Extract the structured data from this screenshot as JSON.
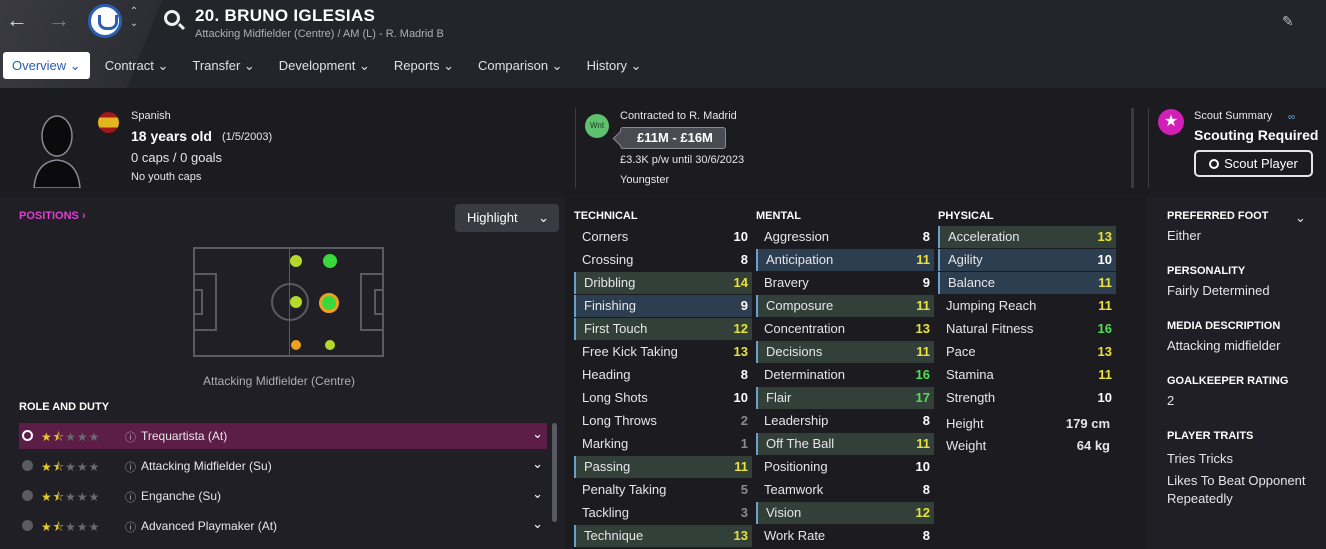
{
  "header": {
    "name": "20. BRUNO IGLESIAS",
    "subtitle": "Attacking Midfielder (Centre) / AM (L) - R. Madrid B"
  },
  "menu": [
    "Overview",
    "Contract",
    "Transfer",
    "Development",
    "Reports",
    "Comparison",
    "History"
  ],
  "bio": {
    "nationality": "Spanish",
    "age": "18 years old",
    "dob": "(1/5/2003)",
    "caps": "0 caps / 0 goals",
    "youth": "No youth caps"
  },
  "contract": {
    "badge": "Wnt",
    "label": "Contracted to R. Madrid",
    "value": "£11M - £16M",
    "wage": "£3.3K p/w until 30/6/2023",
    "status": "Youngster"
  },
  "scout": {
    "label": "Scout Summary",
    "status": "Scouting Required",
    "button": "Scout Player"
  },
  "positions": {
    "label": "POSITIONS",
    "highlight": "Highlight",
    "position_name": "Attacking Midfielder (Centre)"
  },
  "roles": {
    "title": "ROLE AND DUTY",
    "items": [
      "Trequartista (At)",
      "Attacking Midfielder (Su)",
      "Enganche (Su)",
      "Advanced Playmaker (At)"
    ],
    "stars_filled": 1.5,
    "stars_total": 5
  },
  "technical": {
    "title": "TECHNICAL",
    "items": [
      [
        "Corners",
        "10"
      ],
      [
        "Crossing",
        "8"
      ],
      [
        "Dribbling",
        "14"
      ],
      [
        "Finishing",
        "9"
      ],
      [
        "First Touch",
        "12"
      ],
      [
        "Free Kick Taking",
        "13"
      ],
      [
        "Heading",
        "8"
      ],
      [
        "Long Shots",
        "10"
      ],
      [
        "Long Throws",
        "2"
      ],
      [
        "Marking",
        "1"
      ],
      [
        "Passing",
        "11"
      ],
      [
        "Penalty Taking",
        "5"
      ],
      [
        "Tackling",
        "3"
      ],
      [
        "Technique",
        "13"
      ]
    ]
  },
  "mental": {
    "title": "MENTAL",
    "items": [
      [
        "Aggression",
        "8"
      ],
      [
        "Anticipation",
        "11"
      ],
      [
        "Bravery",
        "9"
      ],
      [
        "Composure",
        "11"
      ],
      [
        "Concentration",
        "13"
      ],
      [
        "Decisions",
        "11"
      ],
      [
        "Determination",
        "16"
      ],
      [
        "Flair",
        "17"
      ],
      [
        "Leadership",
        "8"
      ],
      [
        "Off The Ball",
        "11"
      ],
      [
        "Positioning",
        "10"
      ],
      [
        "Teamwork",
        "8"
      ],
      [
        "Vision",
        "12"
      ],
      [
        "Work Rate",
        "8"
      ]
    ]
  },
  "physical": {
    "title": "PHYSICAL",
    "items": [
      [
        "Acceleration",
        "13"
      ],
      [
        "Agility",
        "10"
      ],
      [
        "Balance",
        "11"
      ],
      [
        "Jumping Reach",
        "11"
      ],
      [
        "Natural Fitness",
        "16"
      ],
      [
        "Pace",
        "13"
      ],
      [
        "Stamina",
        "11"
      ],
      [
        "Strength",
        "10"
      ]
    ],
    "height_label": "Height",
    "height": "179 cm",
    "weight_label": "Weight",
    "weight": "64 kg"
  },
  "sidepanel": {
    "foot_label": "PREFERRED FOOT",
    "foot": "Either",
    "personality_label": "PERSONALITY",
    "personality": "Fairly Determined",
    "media_label": "MEDIA DESCRIPTION",
    "media": "Attacking midfielder",
    "gk_label": "GOALKEEPER RATING",
    "gk": "2",
    "traits_label": "PLAYER TRAITS",
    "traits": [
      "Tries Tricks",
      "Likes To Beat Opponent Repeatedly"
    ]
  },
  "colors": {
    "accent": "#e040d0",
    "yellow": "#e8e23a",
    "green": "#4ee04e",
    "grey": "#8a8a94",
    "white": "#ffffff"
  }
}
